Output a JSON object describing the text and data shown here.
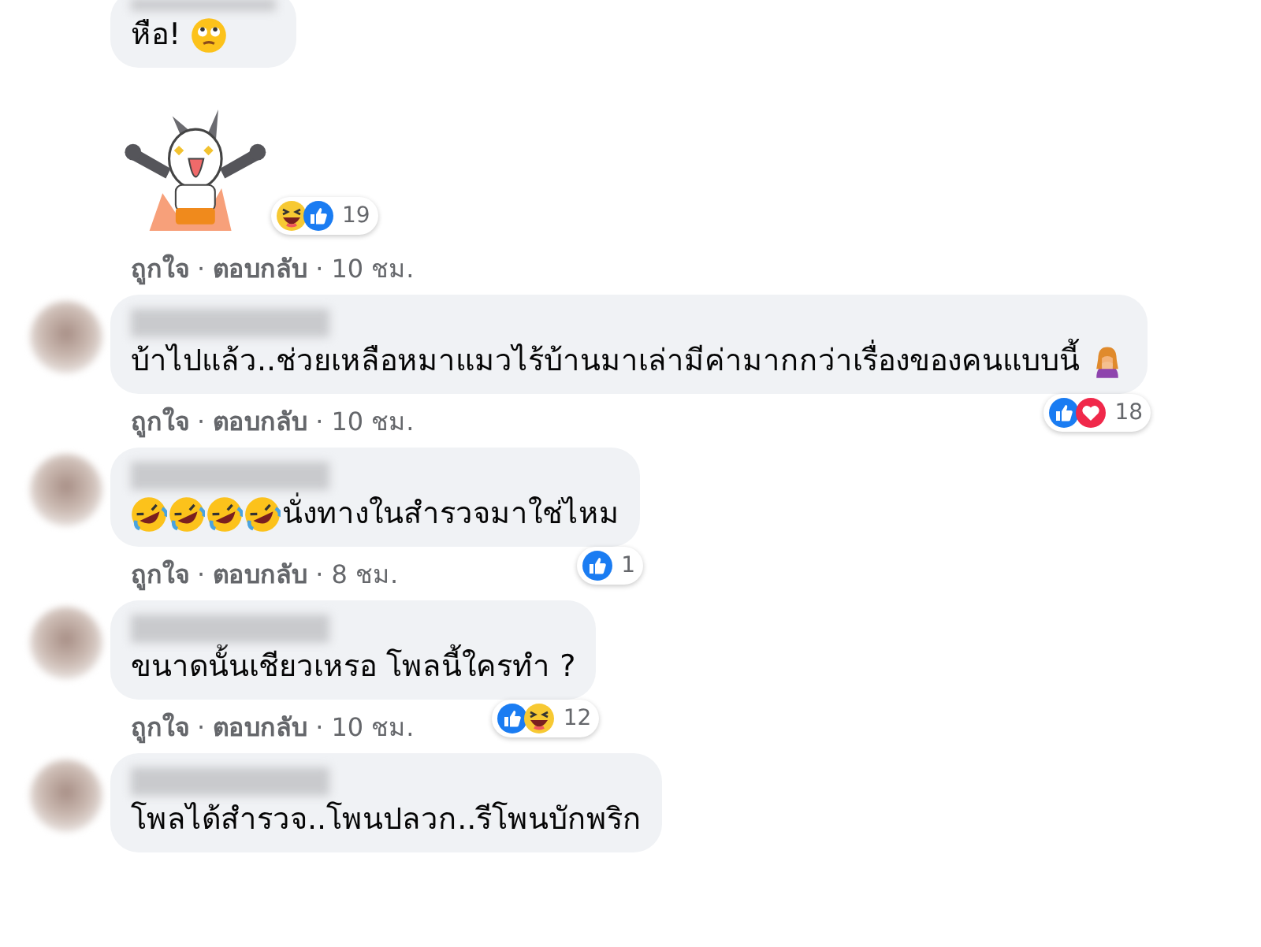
{
  "comments": [
    {
      "text": "หือ!",
      "emojis_after": [
        {
          "kind": "eyeroll"
        }
      ],
      "sticker": true,
      "reactions": [
        {
          "kind": "haha"
        },
        {
          "kind": "like"
        }
      ],
      "reaction_count": "19",
      "meta": [
        {
          "kind": "link",
          "text": "ถูกใจ"
        },
        {
          "kind": "dot",
          "text": "·"
        },
        {
          "kind": "link",
          "text": "ตอบกลับ"
        },
        {
          "kind": "dot",
          "text": "·"
        },
        {
          "kind": "time",
          "text": "10 ชม."
        }
      ]
    },
    {
      "avatar": true,
      "text": "บ้าไปแล้ว..ช่วยเหลือหมาแมวไร้บ้านมาเล่ามีค่ามากกว่าเรื่องของคนแบบนี้",
      "emojis_after": [
        {
          "kind": "facepalm"
        }
      ],
      "reactions": [
        {
          "kind": "like"
        },
        {
          "kind": "love"
        }
      ],
      "reaction_count": "18",
      "meta": [
        {
          "kind": "link",
          "text": "ถูกใจ"
        },
        {
          "kind": "dot",
          "text": "·"
        },
        {
          "kind": "link",
          "text": "ตอบกลับ"
        },
        {
          "kind": "dot",
          "text": "·"
        },
        {
          "kind": "time",
          "text": "10 ชม."
        }
      ]
    },
    {
      "avatar": true,
      "text": "นั่งทางในสำรวจมาใช่ไหม",
      "emojis_before": [
        {
          "kind": "rofl"
        },
        {
          "kind": "rofl"
        },
        {
          "kind": "rofl"
        },
        {
          "kind": "rofl"
        }
      ],
      "reactions": [
        {
          "kind": "like"
        }
      ],
      "reaction_count": "1",
      "meta": [
        {
          "kind": "link",
          "text": "ถูกใจ"
        },
        {
          "kind": "dot",
          "text": "·"
        },
        {
          "kind": "link",
          "text": "ตอบกลับ"
        },
        {
          "kind": "dot",
          "text": "·"
        },
        {
          "kind": "time",
          "text": "8 ชม."
        }
      ]
    },
    {
      "avatar": true,
      "text": "ขนาดนั้นเชียวเหรอ โพลนี้ใครทำ ?",
      "reactions": [
        {
          "kind": "like"
        },
        {
          "kind": "haha"
        }
      ],
      "reaction_count": "12",
      "meta": [
        {
          "kind": "link",
          "text": "ถูกใจ"
        },
        {
          "kind": "dot",
          "text": "·"
        },
        {
          "kind": "link",
          "text": "ตอบกลับ"
        },
        {
          "kind": "dot",
          "text": "·"
        },
        {
          "kind": "time",
          "text": "10 ชม."
        }
      ]
    },
    {
      "avatar": true,
      "text": "โพลได้สำรวจ..โพนปลวก..รีโพนบักพริก"
    }
  ]
}
